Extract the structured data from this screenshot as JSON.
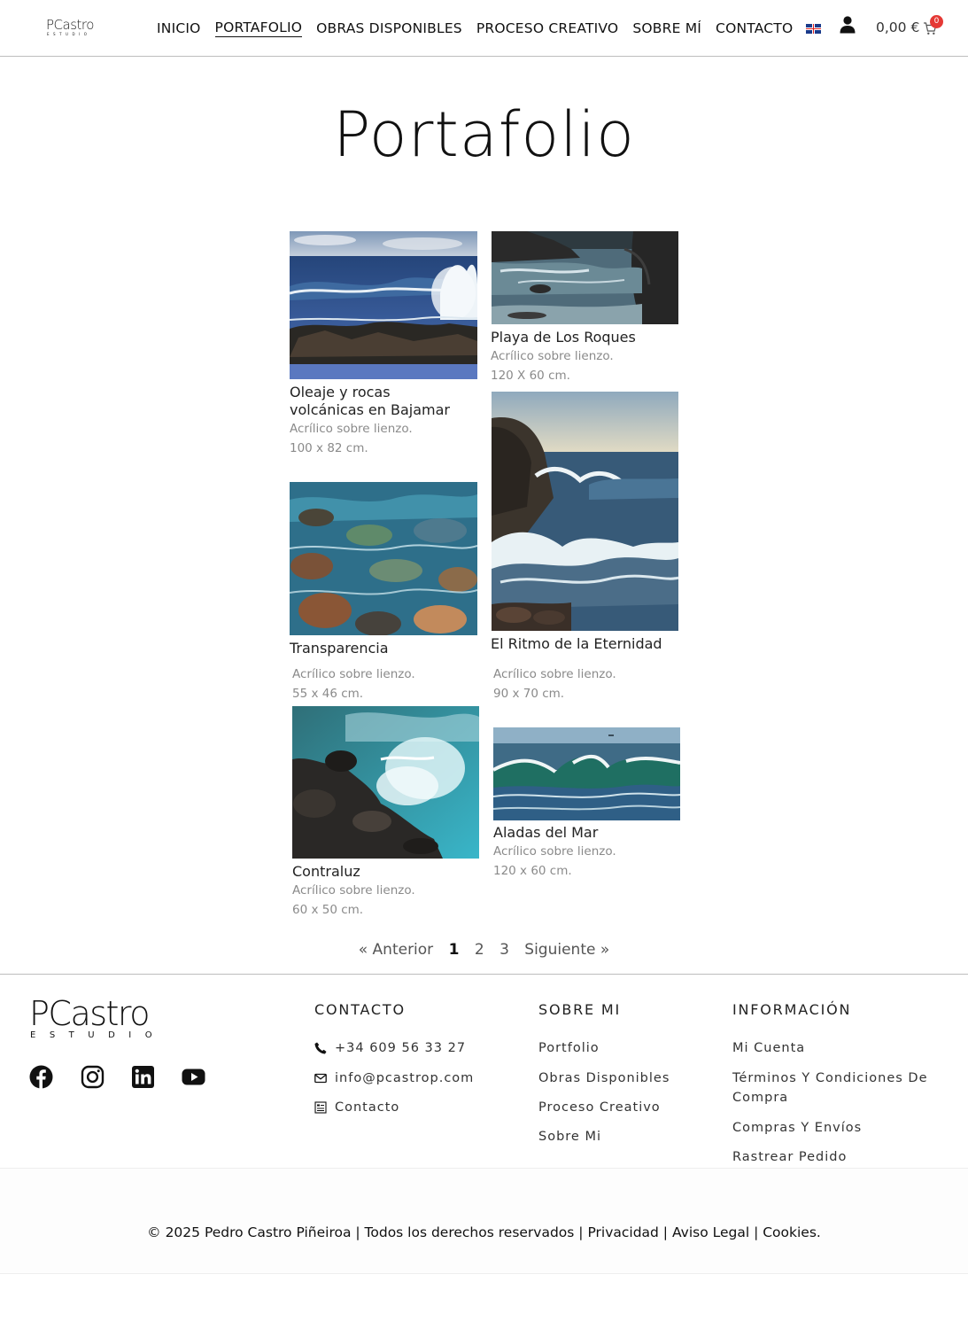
{
  "header": {
    "logo_text": "PCastro",
    "logo_sub": "ESTUDIO",
    "nav": [
      {
        "label": "INICIO"
      },
      {
        "label": "PORTAFOLIO"
      },
      {
        "label": "OBRAS DISPONIBLES"
      },
      {
        "label": "PROCESO CREATIVO"
      },
      {
        "label": "SOBRE MÍ"
      },
      {
        "label": "CONTACTO"
      }
    ],
    "cart_total": "0,00 €",
    "cart_count": "0"
  },
  "page_title": "Portafolio",
  "artworks": [
    {
      "title": "Oleaje y rocas",
      "title2": "volcánicas en Bajamar",
      "medium": "Acrílico sobre lienzo.",
      "size": "100 x 82 cm."
    },
    {
      "title": "Playa de Los Roques",
      "medium": "Acrílico sobre lienzo.",
      "size": "120 X 60 cm."
    },
    {
      "title": "Transparencia",
      "medium": "Acrílico sobre lienzo.",
      "size": "55 x 46 cm."
    },
    {
      "title": "El Ritmo de la Eternidad",
      "medium": "Acrílico sobre lienzo.",
      "size": "90 x 70 cm."
    },
    {
      "title": "Contraluz",
      "medium": "Acrílico sobre lienzo.",
      "size": "60 x 50 cm."
    },
    {
      "title": "Aladas del Mar",
      "medium": "Acrílico sobre lienzo.",
      "size": "120 x 60 cm."
    }
  ],
  "pagination": {
    "prev": "« Anterior",
    "pages": [
      "1",
      "2",
      "3"
    ],
    "next": "Siguiente »"
  },
  "footer": {
    "logo_text": "PCastro",
    "logo_sub": "ESTUDIO",
    "contact_heading": "CONTACTO",
    "phone": "+34 609 56 33 27",
    "email": "info@pcastrop.com",
    "contact_link": "Contacto",
    "about_heading": "SOBRE MI",
    "about_links": [
      "Portfolio",
      "Obras Disponibles",
      "Proceso Creativo",
      "Sobre Mi"
    ],
    "info_heading": "INFORMACIÓN",
    "info_links": [
      "Mi Cuenta",
      "Términos Y Condiciones De",
      "Compra",
      "Compras Y Envíos",
      "Rastrear Pedido"
    ],
    "copyright": "© 2025 Pedro Castro Piñeiroa | Todos los derechos reservados | Privacidad | Aviso Legal | Cookies."
  }
}
